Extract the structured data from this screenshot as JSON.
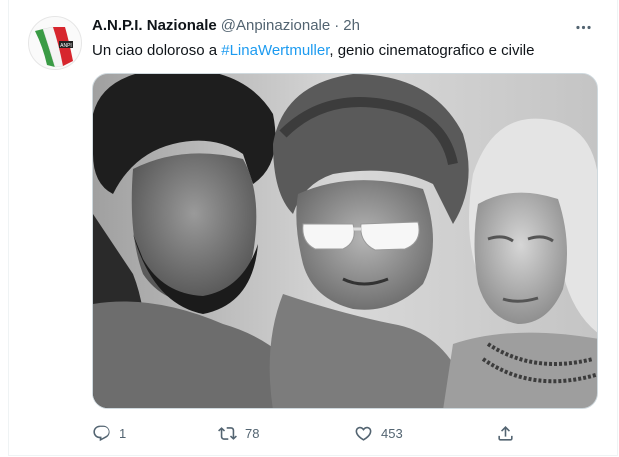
{
  "tweet": {
    "display_name": "A.N.P.I. Nazionale",
    "handle": "@Anpinazionale",
    "separator": "·",
    "time": "2h",
    "text_before": "Un ciao doloroso a ",
    "hashtag": "#LinaWertmuller",
    "text_after": ", genio cinematografico e civile",
    "avatar_icon": "italian-flag-logo-icon",
    "media_description": "black-and-white-photo"
  },
  "actions": {
    "replies": "1",
    "retweets": "78",
    "likes": "453",
    "reply_icon": "reply-icon",
    "retweet_icon": "retweet-icon",
    "like_icon": "heart-icon",
    "share_icon": "share-icon"
  },
  "colors": {
    "accent": "#1d9bf0",
    "secondary_text": "#536471",
    "primary_text": "#0f1419",
    "border": "#cfd9de"
  }
}
